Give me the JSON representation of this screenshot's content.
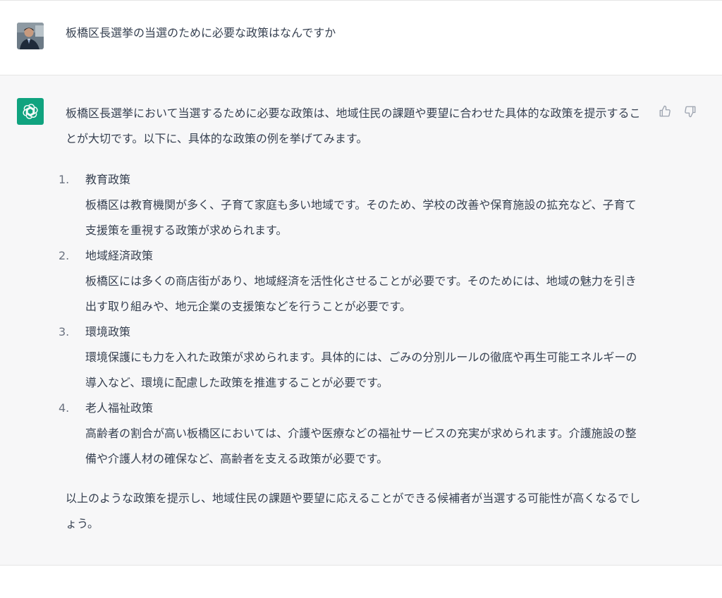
{
  "user": {
    "message": "板橋区長選挙の当選のために必要な政策はなんですか"
  },
  "assistant": {
    "intro": "板橋区長選挙において当選するために必要な政策は、地域住民の課題や要望に合わせた具体的な政策を提示することが大切です。以下に、具体的な政策の例を挙げてみます。",
    "items": [
      {
        "number": "1.",
        "title": "教育政策",
        "body": "板橋区は教育機関が多く、子育て家庭も多い地域です。そのため、学校の改善や保育施設の拡充など、子育て支援策を重視する政策が求められます。"
      },
      {
        "number": "2.",
        "title": "地域経済政策",
        "body": "板橋区には多くの商店街があり、地域経済を活性化させることが必要です。そのためには、地域の魅力を引き出す取り組みや、地元企業の支援策などを行うことが必要です。"
      },
      {
        "number": "3.",
        "title": "環境政策",
        "body": "環境保護にも力を入れた政策が求められます。具体的には、ごみの分別ルールの徹底や再生可能エネルギーの導入など、環境に配慮した政策を推進することが必要です。"
      },
      {
        "number": "4.",
        "title": "老人福祉政策",
        "body": "高齢者の割合が高い板橋区においては、介護や医療などの福祉サービスの充実が求められます。介護施設の整備や介護人材の確保など、高齢者を支える政策が必要です。"
      }
    ],
    "conclusion": "以上のような政策を提示し、地域住民の課題や要望に応えることができる候補者が当選する可能性が高くなるでしょう。"
  },
  "icons": {
    "user_avatar": "user-photo-avatar",
    "bot_avatar": "openai-logo-icon",
    "thumbs_up": "thumbs-up-icon",
    "thumbs_down": "thumbs-down-icon"
  },
  "colors": {
    "bot_avatar_bg": "#10a37f",
    "assistant_bg": "#f7f7f8",
    "text": "#374151"
  }
}
